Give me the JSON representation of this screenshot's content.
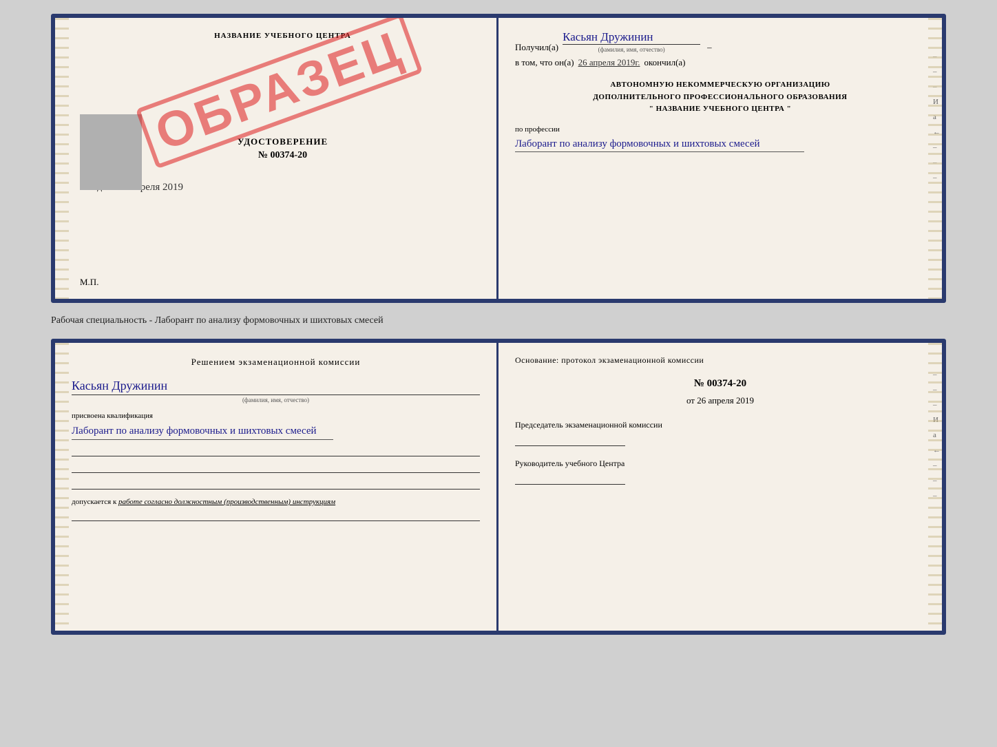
{
  "top_cert": {
    "left": {
      "school_name": "НАЗВАНИЕ УЧЕБНОГО ЦЕНТРА",
      "stamp_text": "ОБРАЗЕЦ",
      "udost_label": "УДОСТОВЕРЕНИЕ",
      "udost_number": "№ 00374-20",
      "vydano_label": "Выдано",
      "vydano_date": "26 апреля 2019",
      "mp_label": "М.П."
    },
    "right": {
      "poluchil_label": "Получил(а)",
      "poluchil_name": "Касьян Дружинин",
      "fio_sub": "(фамилия, имя, отчество)",
      "vtom_label": "в том, что он(а)",
      "vtom_date": "26 апреля 2019г.",
      "okonchil": "окончил(а)",
      "org_line1": "АВТОНОМНУЮ НЕКОММЕРЧЕСКУЮ ОРГАНИЗАЦИЮ",
      "org_line2": "ДОПОЛНИТЕЛЬНОГО ПРОФЕССИОНАЛЬНОГО ОБРАЗОВАНИЯ",
      "org_line3": "\"  НАЗВАНИЕ УЧЕБНОГО ЦЕНТРА  \"",
      "po_professii_label": "по профессии",
      "po_professii_hand": "Лаборант по анализу формовочных и шихтовых смесей"
    }
  },
  "middle_text": "Рабочая специальность - Лаборант по анализу формовочных и шихтовых смесей",
  "bottom_cert": {
    "left": {
      "resheniem_title": "Решением  экзаменационной  комиссии",
      "kasyan_name": "Касьян  Дружинин",
      "fam_sub": "(фамилия, имя, отчество)",
      "prisvoena_label": "присвоена квалификация",
      "kvalif_hand": "Лаборант по анализу формовочных и шихтовых смесей",
      "dopusk_label": "допускается к",
      "dopusk_text": "работе согласно должностным (производственным) инструкциям"
    },
    "right": {
      "osnovanie_title": "Основание: протокол экзаменационной  комиссии",
      "protocol_number": "№ 00374-20",
      "ot_label": "от",
      "ot_date": "26 апреля 2019",
      "predsedatel_label": "Председатель экзаменационной комиссии",
      "rukovoditel_label": "Руководитель учебного Центра"
    }
  },
  "right_margin_chars": [
    "–",
    "–",
    "–",
    "И",
    "а",
    "←",
    "–",
    "–",
    "–"
  ]
}
